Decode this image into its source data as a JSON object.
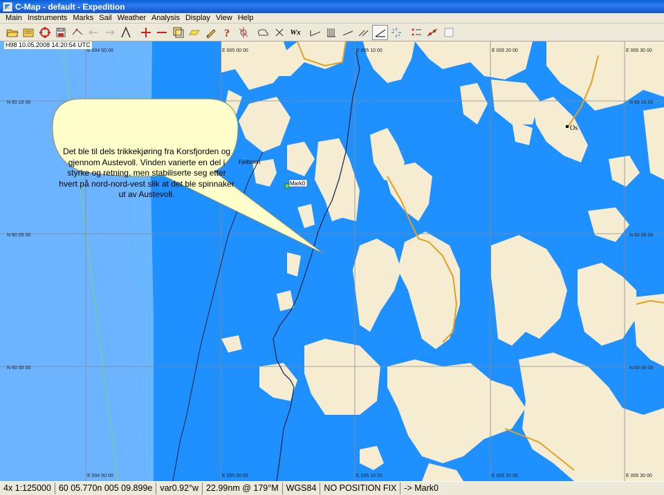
{
  "window": {
    "title": "C-Map - default - Expedition"
  },
  "menu": [
    "Main",
    "Instruments",
    "Marks",
    "Sail",
    "Weather",
    "Analysis",
    "Display",
    "View",
    "Help"
  ],
  "toolbar": {
    "icons": [
      "open-folder-icon",
      "folder-icon",
      "target-icon",
      "save-icon",
      "route-icon",
      "undo-icon",
      "redo-icon",
      "lambda-icon",
      "add-mark-icon",
      "line-icon",
      "layers-icon",
      "highlight-icon",
      "pencil-icon",
      "help-icon",
      "compass-icon",
      "weather-icon",
      "close-icon",
      "wx-icon",
      "polar-icon",
      "grid-icon",
      "slope-icon",
      "double-slope-icon",
      "angle-icon",
      "spinner-icon",
      "marks-list-icon",
      "wind-icon",
      "window-icon"
    ],
    "wx_label": "Wx"
  },
  "map": {
    "timestamp": "H98 10.05.2008 14:20:54 UTC",
    "lon_labels_top": [
      "E 004 50 00",
      "E 005 00 00",
      "E 005 10 00",
      "E 005 20 00",
      "E 005 30 00"
    ],
    "lon_labels_bottom": [
      "E 004 50 00",
      "E 005 00 00",
      "E 005 10 00",
      "E 005 20 00",
      "E 005 30 00"
    ],
    "lat_labels": [
      "N 60 10 00",
      "N 60 05 00",
      "N 60 00 00"
    ],
    "place_labels": {
      "os": "Os",
      "partial_island": "Fjellstein"
    },
    "mark_label": "Mark0",
    "callout": "Det ble til dels trikkekjøring fra Korsfjorden og gjennom Austevoll. Vinden varierte en del i styrke og retning, men stabiliserte seg etter hvert på nord-nord-vest slik at det ble spinnaker ut av Austevoll.",
    "colors": {
      "sea": "#1e90ff",
      "shallow": "#6cb4ff",
      "land": "#f5ecd2",
      "road": "#e0a020",
      "track": "#1a2a50"
    }
  },
  "status": {
    "zoom": "4x 1:125000",
    "position": "60 05.770n 005 09.899e",
    "variation": "var0.92°w",
    "range_bearing": "22.99nm @ 179°M",
    "datum": "WGS84",
    "fix": "NO POSITION FIX",
    "target": "-> Mark0"
  }
}
